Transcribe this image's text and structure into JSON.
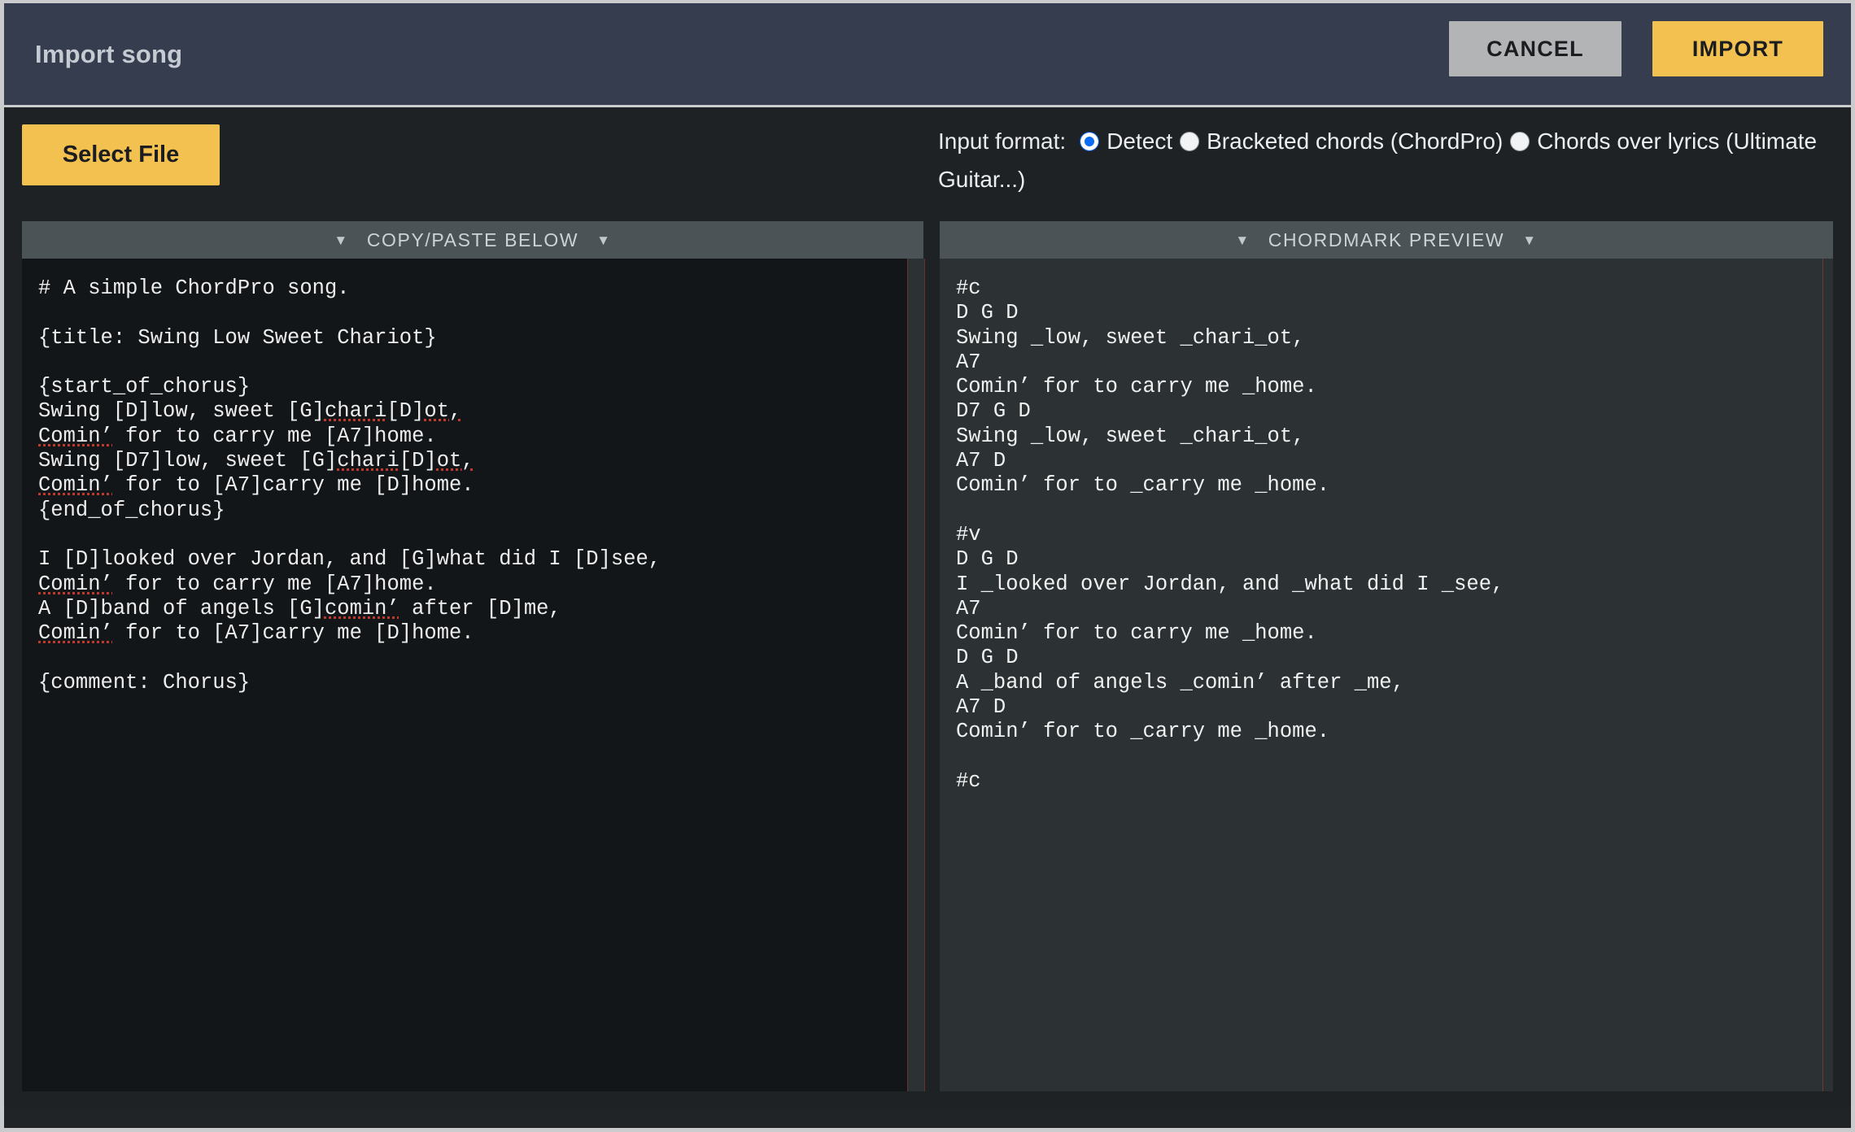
{
  "window": {
    "title": "Import song"
  },
  "header": {
    "cancel_label": "CANCEL",
    "import_label": "IMPORT"
  },
  "controls": {
    "select_file_label": "Select File",
    "input_format_label": "Input format:",
    "options": [
      {
        "label": "Detect",
        "selected": true
      },
      {
        "label": "Bracketed chords (ChordPro)",
        "selected": false
      },
      {
        "label": "Chords over lyrics (Ultimate Guitar...)",
        "selected": false
      }
    ]
  },
  "editor_panel": {
    "header_title": "COPY/PASTE BELOW",
    "caret_left": "▼",
    "caret_right": "▼",
    "content": "# A simple ChordPro song.\n\n{title: Swing Low Sweet Chariot}\n\n{start_of_chorus}\nSwing [D]low, sweet [G]chari[D]ot,\nComin’ for to carry me [A7]home.\nSwing [D7]low, sweet [G]chari[D]ot,\nComin’ for to [A7]carry me [D]home.\n{end_of_chorus}\n\nI [D]looked over Jordan, and [G]what did I [D]see,\nComin’ for to carry me [A7]home.\nA [D]band of angels [G]comin’ after [D]me,\nComin’ for to [A7]carry me [D]home.\n\n{comment: Chorus}"
  },
  "preview_panel": {
    "header_title": "CHORDMARK PREVIEW",
    "caret_left": "▼",
    "caret_right": "▼",
    "content": "#c\nD G D\nSwing _low, sweet _chari_ot,\nA7\nComin’ for to carry me _home.\nD7 G D\nSwing _low, sweet _chari_ot,\nA7 D\nComin’ for to _carry me _home.\n\n#v\nD G D\nI _looked over Jordan, and _what did I _see,\nA7\nComin’ for to carry me _home.\nD G D\nA _band of angels _comin’ after _me,\nA7 D\nComin’ for to _carry me _home.\n\n#c"
  },
  "colors": {
    "accent_yellow": "#f3c14f",
    "header_navy": "#363d4f",
    "panel_header_gray": "#4b5357",
    "editor_bg": "#131618",
    "preview_bg": "#2c3134",
    "radio_selected_blue": "#0a6cf5",
    "spellcheck_red": "#c0392b"
  }
}
